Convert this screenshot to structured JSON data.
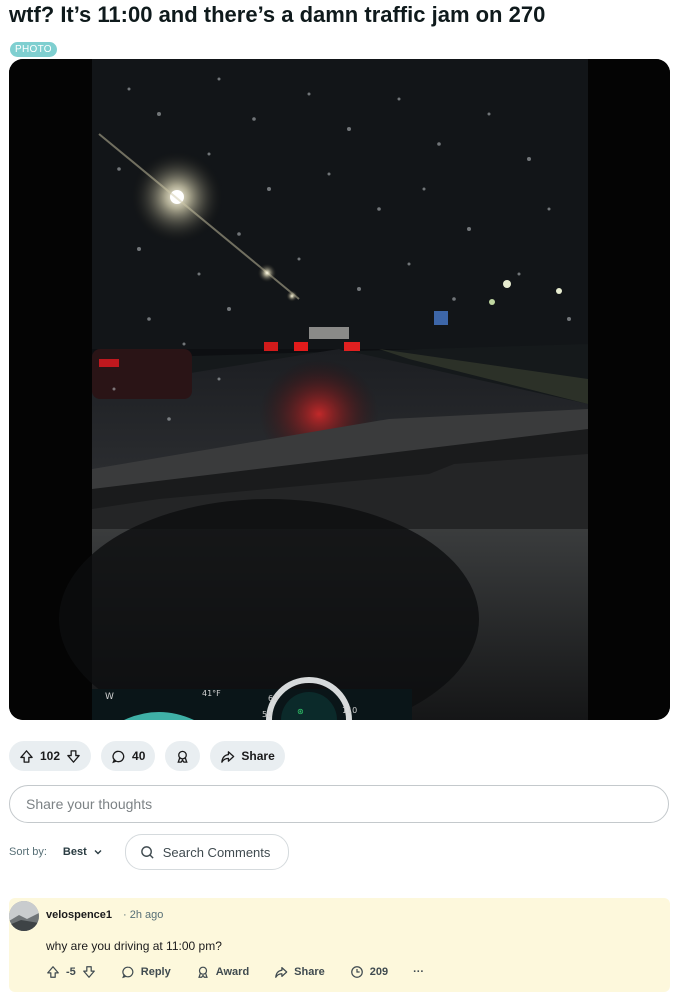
{
  "post": {
    "title": "wtf? It’s 11:00 and there’s a damn traffic jam on 270",
    "flair": "PHOTO",
    "image_alt": "Night rainy highway view through windshield with traffic brake lights",
    "votes": "102",
    "comments": "40",
    "share_label": "Share"
  },
  "composer": {
    "placeholder": "Share your thoughts"
  },
  "sort": {
    "label": "Sort by:",
    "value": "Best",
    "search_label": "Search Comments"
  },
  "comment": {
    "username": "velospence1",
    "time": "· 2h ago",
    "text": "why are you driving at 11:00 pm?",
    "votes": "-5",
    "reply_label": "Reply",
    "award_label": "Award",
    "share_label": "Share",
    "views": "209",
    "more": "···"
  },
  "icons": [
    "upvote-icon",
    "downvote-icon",
    "comment-icon",
    "award-icon",
    "share-icon",
    "search-icon",
    "chevron-down-icon",
    "views-icon",
    "more-icon"
  ]
}
